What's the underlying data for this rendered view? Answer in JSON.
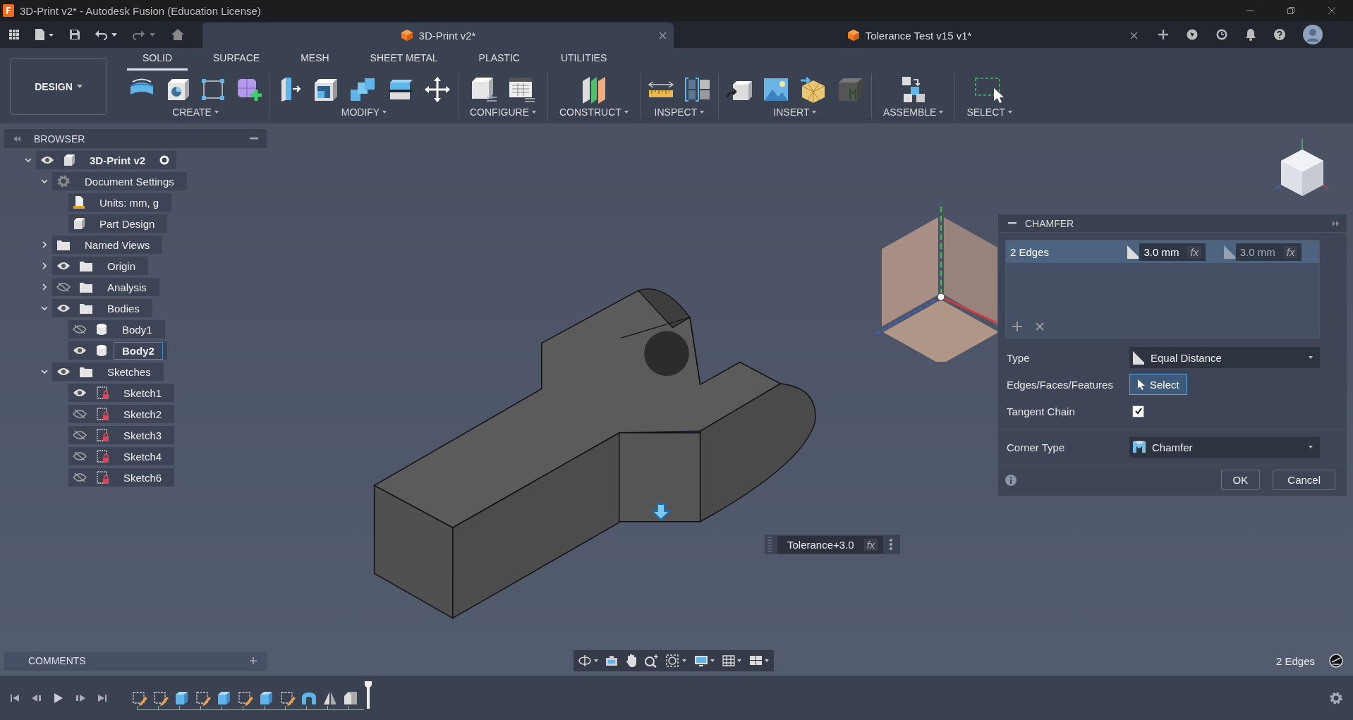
{
  "window": {
    "title": "3D-Print v2* - Autodesk Fusion (Education License)"
  },
  "document_tabs": [
    {
      "label": "3D-Print v2*",
      "selected": true
    },
    {
      "label": "Tolerance Test v15 v1*",
      "selected": false
    }
  ],
  "workspace": {
    "label": "DESIGN"
  },
  "ribbon_tabs": [
    {
      "label": "SOLID",
      "selected": true
    },
    {
      "label": "SURFACE",
      "selected": false
    },
    {
      "label": "MESH",
      "selected": false
    },
    {
      "label": "SHEET METAL",
      "selected": false
    },
    {
      "label": "PLASTIC",
      "selected": false
    },
    {
      "label": "UTILITIES",
      "selected": false
    }
  ],
  "ribbon_groups": [
    {
      "label": "CREATE"
    },
    {
      "label": "MODIFY"
    },
    {
      "label": "CONFIGURE"
    },
    {
      "label": "CONSTRUCT"
    },
    {
      "label": "INSPECT"
    },
    {
      "label": "INSERT"
    },
    {
      "label": "ASSEMBLE"
    },
    {
      "label": "SELECT"
    }
  ],
  "browser": {
    "title": "BROWSER",
    "tree": [
      {
        "label": "3D-Print v2",
        "kind": "component",
        "visible": true,
        "expanded": true,
        "selected": false,
        "children": [
          {
            "label": "Document Settings",
            "kind": "settings",
            "expanded": true,
            "selected": false,
            "children": [
              {
                "label": "Units: mm, g",
                "kind": "units",
                "selected": false
              },
              {
                "label": "Part Design",
                "kind": "design",
                "selected": false
              }
            ]
          },
          {
            "label": "Named Views",
            "kind": "folder",
            "expanded": false,
            "selected": false
          },
          {
            "label": "Origin",
            "kind": "folder",
            "visible": true,
            "expanded": false,
            "selected": false
          },
          {
            "label": "Analysis",
            "kind": "folder",
            "visible": false,
            "expanded": false,
            "selected": false
          },
          {
            "label": "Bodies",
            "kind": "folder",
            "visible": true,
            "expanded": true,
            "selected": false,
            "children": [
              {
                "label": "Body1",
                "kind": "body",
                "visible": false,
                "selected": false
              },
              {
                "label": "Body2",
                "kind": "body",
                "visible": true,
                "selected": true
              }
            ]
          },
          {
            "label": "Sketches",
            "kind": "folder",
            "visible": true,
            "expanded": true,
            "selected": false,
            "children": [
              {
                "label": "Sketch1",
                "kind": "sketch",
                "visible": true,
                "selected": false
              },
              {
                "label": "Sketch2",
                "kind": "sketch",
                "visible": false,
                "selected": false
              },
              {
                "label": "Sketch3",
                "kind": "sketch",
                "visible": false,
                "selected": false
              },
              {
                "label": "Sketch4",
                "kind": "sketch",
                "visible": false,
                "selected": false
              },
              {
                "label": "Sketch6",
                "kind": "sketch",
                "visible": false,
                "selected": false
              }
            ]
          }
        ]
      }
    ]
  },
  "chamfer": {
    "title": "CHAMFER",
    "selection": {
      "label": "2 Edges",
      "selected": true,
      "distances": [
        {
          "value": "3.0 mm",
          "fx": "fx",
          "disabled": false
        },
        {
          "value": "3.0 mm",
          "fx": "fx",
          "disabled": true
        }
      ]
    },
    "rows": [
      {
        "kind": "dropdown",
        "label": "Type",
        "value": "Equal Distance"
      },
      {
        "kind": "select",
        "label": "Edges/Faces/Features",
        "value": "Select",
        "active": true
      },
      {
        "kind": "checkbox",
        "label": "Tangent Chain",
        "checked": true
      },
      {
        "kind": "dropdown",
        "label": "Corner Type",
        "value": "Chamfer"
      }
    ],
    "buttons": [
      "OK",
      "Cancel"
    ]
  },
  "distance_input": {
    "value": "Tolerance+3.0",
    "fx": "fx"
  },
  "comments": {
    "title": "COMMENTS"
  },
  "status": {
    "text": "2 Edges"
  },
  "timeline": {
    "features": [
      {
        "kind": "sketch"
      },
      {
        "kind": "sketch"
      },
      {
        "kind": "extrude"
      },
      {
        "kind": "sketch"
      },
      {
        "kind": "extrude"
      },
      {
        "kind": "sketch"
      },
      {
        "kind": "extrude"
      },
      {
        "kind": "sketch"
      },
      {
        "kind": "fillet"
      },
      {
        "kind": "mirror"
      },
      {
        "kind": "chamfer"
      }
    ]
  }
}
